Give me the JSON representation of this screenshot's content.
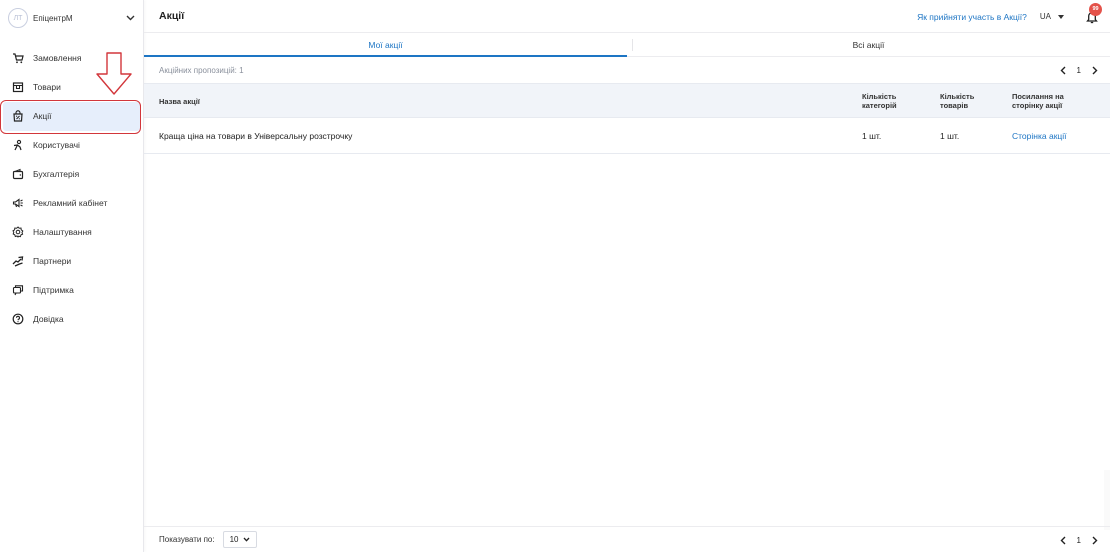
{
  "account": {
    "avatar_initials": "ЛТ",
    "name": "ЕпіцентрМ"
  },
  "sidebar": {
    "items": [
      {
        "label": "Замовлення",
        "icon": "cart-icon"
      },
      {
        "label": "Товари",
        "icon": "store-icon"
      },
      {
        "label": "Акції",
        "icon": "discount-bag-icon"
      },
      {
        "label": "Користувачі",
        "icon": "user-icon"
      },
      {
        "label": "Бухгалтерія",
        "icon": "wallet-icon"
      },
      {
        "label": "Рекламний кабінет",
        "icon": "megaphone-icon"
      },
      {
        "label": "Налаштування",
        "icon": "gear-icon"
      },
      {
        "label": "Партнери",
        "icon": "handshake-icon"
      },
      {
        "label": "Підтримка",
        "icon": "chat-icon"
      },
      {
        "label": "Довідка",
        "icon": "help-icon"
      }
    ],
    "active_index": 2
  },
  "header": {
    "title": "Акції",
    "help_link": "Як прийняти участь в Акції?",
    "language": "UA",
    "notifications_count": "99"
  },
  "tabs": {
    "my": "Мої акції",
    "all": "Всі акції"
  },
  "list": {
    "count_text": "Акційних пропозицій: 1",
    "page": "1"
  },
  "table": {
    "headers": {
      "name": "Назва акції",
      "categories": "Кількість категорій",
      "products": "Кількість товарів",
      "link": "Посилання на сторінку акції"
    },
    "rows": [
      {
        "name": "Краща ціна на товари в Універсальну розстрочку",
        "categories": "1 шт.",
        "products": "1 шт.",
        "link": "Сторінка акції"
      }
    ]
  },
  "footer": {
    "show_label": "Показувати по:",
    "per_page": "10",
    "page": "1"
  },
  "colors": {
    "accent": "#1d75c4",
    "active_bg": "#e6eefb",
    "highlight_ring": "#d2363b",
    "badge": "#e4524a"
  }
}
